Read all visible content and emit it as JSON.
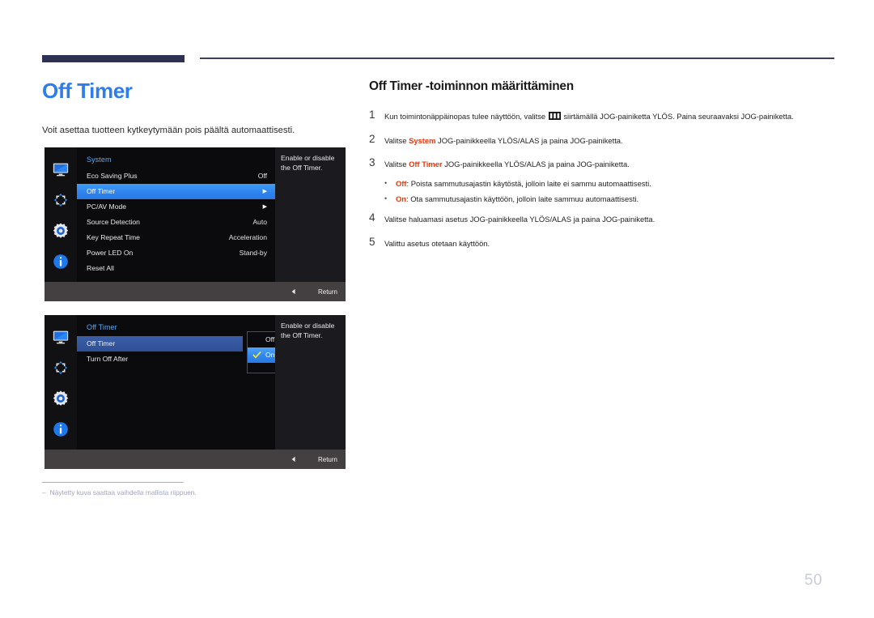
{
  "page_title": "Off Timer",
  "intro": "Voit asettaa tuotteen kytkeytymään pois päältä automaattisesti.",
  "section_title": "Off Timer -toiminnon määrittäminen",
  "steps": [
    {
      "num": "1",
      "text_before": "Kun toimintonäppäinopas tulee näyttöön, valitse",
      "icon": "menu-icon",
      "text_after": "siirtämällä JOG-painiketta YLÖS. Paina seuraavaksi JOG-painiketta."
    },
    {
      "num": "2",
      "text_before": "Valitse",
      "highlight": "System",
      "text_after": "JOG-painikkeella YLÖS/ALAS ja paina JOG-painiketta."
    },
    {
      "num": "3",
      "text_before": "Valitse",
      "highlight": "Off Timer",
      "text_after": "JOG-painikkeella YLÖS/ALAS ja paina JOG-painiketta."
    },
    {
      "num": "4",
      "text_before": "Valitse haluamasi asetus JOG-painikkeella YLÖS/ALAS ja paina JOG-painiketta.",
      "highlight": "",
      "text_after": ""
    },
    {
      "num": "5",
      "text_before": "Valittu asetus otetaan käyttöön.",
      "highlight": "",
      "text_after": ""
    }
  ],
  "bullets": [
    {
      "marker": "•",
      "highlight": "Off",
      "text": ": Poista sammutusajastin käytöstä, jolloin laite ei sammu automaattisesti."
    },
    {
      "marker": "•",
      "highlight": "On",
      "text": ": Ota sammutusajastin käyttöön, jolloin laite sammuu automaattisesti."
    }
  ],
  "osd_first": {
    "panel_title": "System",
    "rows": [
      {
        "label": "Eco Saving Plus",
        "value": "Off",
        "arrow": "",
        "state": "normal"
      },
      {
        "label": "Off Timer",
        "value": "",
        "arrow": "▶",
        "state": "selected"
      },
      {
        "label": "PC/AV Mode",
        "value": "",
        "arrow": "▶",
        "state": "normal"
      },
      {
        "label": "Source Detection",
        "value": "Auto",
        "arrow": "",
        "state": "normal"
      },
      {
        "label": "Key Repeat Time",
        "value": "Acceleration",
        "arrow": "",
        "state": "normal"
      },
      {
        "label": "Power LED On",
        "value": "Stand-by",
        "arrow": "",
        "state": "normal"
      },
      {
        "label": "Reset All",
        "value": "",
        "arrow": "",
        "state": "normal"
      }
    ],
    "description": "Enable or disable the Off Timer.",
    "return_label": "Return",
    "sidebar_icons": [
      "display-icon",
      "picture-adjust-icon",
      "settings-gear-icon",
      "information-icon"
    ]
  },
  "osd_second": {
    "panel_title": "Off Timer",
    "rows": [
      {
        "label": "Off Timer",
        "value": "",
        "arrow": "",
        "state": "selected-dim"
      },
      {
        "label": "Turn Off After",
        "value": "",
        "arrow": "",
        "state": "normal"
      }
    ],
    "popup_options": [
      {
        "label": "Off",
        "checked": false
      },
      {
        "label": "On",
        "checked": true
      }
    ],
    "description": "Enable or disable the Off Timer.",
    "return_label": "Return",
    "sidebar_icons": [
      "display-icon",
      "picture-adjust-icon",
      "settings-gear-icon",
      "information-icon"
    ]
  },
  "footnote": {
    "dash": "‒",
    "text": "Näytetty kuva saattaa vaihdella mallista riippuen."
  },
  "page_number": "50",
  "colors": {
    "title_blue": "#2f7ded",
    "rule_navy": "#2e3152",
    "highlight_red": "#e8380d",
    "osd_select_blue": "#2f84ee",
    "osd_select_dim": "#2f4f95",
    "check_yellow": "#e9e12a",
    "footnote_gray": "#a3a6bd",
    "page_num_gray": "#c9ccd8"
  }
}
